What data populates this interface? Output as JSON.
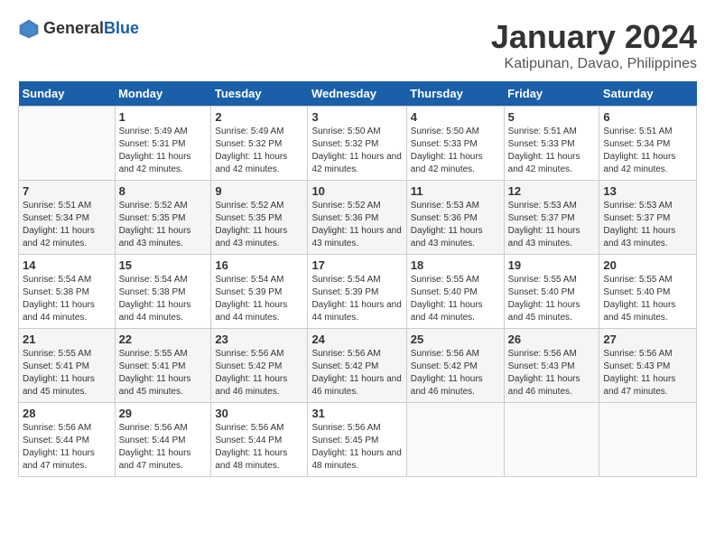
{
  "logo": {
    "text_general": "General",
    "text_blue": "Blue"
  },
  "title": "January 2024",
  "subtitle": "Katipunan, Davao, Philippines",
  "days_of_week": [
    "Sunday",
    "Monday",
    "Tuesday",
    "Wednesday",
    "Thursday",
    "Friday",
    "Saturday"
  ],
  "weeks": [
    [
      {
        "day": "",
        "sunrise": "",
        "sunset": "",
        "daylight": "",
        "empty": true
      },
      {
        "day": "1",
        "sunrise": "Sunrise: 5:49 AM",
        "sunset": "Sunset: 5:31 PM",
        "daylight": "Daylight: 11 hours and 42 minutes."
      },
      {
        "day": "2",
        "sunrise": "Sunrise: 5:49 AM",
        "sunset": "Sunset: 5:32 PM",
        "daylight": "Daylight: 11 hours and 42 minutes."
      },
      {
        "day": "3",
        "sunrise": "Sunrise: 5:50 AM",
        "sunset": "Sunset: 5:32 PM",
        "daylight": "Daylight: 11 hours and 42 minutes."
      },
      {
        "day": "4",
        "sunrise": "Sunrise: 5:50 AM",
        "sunset": "Sunset: 5:33 PM",
        "daylight": "Daylight: 11 hours and 42 minutes."
      },
      {
        "day": "5",
        "sunrise": "Sunrise: 5:51 AM",
        "sunset": "Sunset: 5:33 PM",
        "daylight": "Daylight: 11 hours and 42 minutes."
      },
      {
        "day": "6",
        "sunrise": "Sunrise: 5:51 AM",
        "sunset": "Sunset: 5:34 PM",
        "daylight": "Daylight: 11 hours and 42 minutes."
      }
    ],
    [
      {
        "day": "7",
        "sunrise": "Sunrise: 5:51 AM",
        "sunset": "Sunset: 5:34 PM",
        "daylight": "Daylight: 11 hours and 42 minutes."
      },
      {
        "day": "8",
        "sunrise": "Sunrise: 5:52 AM",
        "sunset": "Sunset: 5:35 PM",
        "daylight": "Daylight: 11 hours and 43 minutes."
      },
      {
        "day": "9",
        "sunrise": "Sunrise: 5:52 AM",
        "sunset": "Sunset: 5:35 PM",
        "daylight": "Daylight: 11 hours and 43 minutes."
      },
      {
        "day": "10",
        "sunrise": "Sunrise: 5:52 AM",
        "sunset": "Sunset: 5:36 PM",
        "daylight": "Daylight: 11 hours and 43 minutes."
      },
      {
        "day": "11",
        "sunrise": "Sunrise: 5:53 AM",
        "sunset": "Sunset: 5:36 PM",
        "daylight": "Daylight: 11 hours and 43 minutes."
      },
      {
        "day": "12",
        "sunrise": "Sunrise: 5:53 AM",
        "sunset": "Sunset: 5:37 PM",
        "daylight": "Daylight: 11 hours and 43 minutes."
      },
      {
        "day": "13",
        "sunrise": "Sunrise: 5:53 AM",
        "sunset": "Sunset: 5:37 PM",
        "daylight": "Daylight: 11 hours and 43 minutes."
      }
    ],
    [
      {
        "day": "14",
        "sunrise": "Sunrise: 5:54 AM",
        "sunset": "Sunset: 5:38 PM",
        "daylight": "Daylight: 11 hours and 44 minutes."
      },
      {
        "day": "15",
        "sunrise": "Sunrise: 5:54 AM",
        "sunset": "Sunset: 5:38 PM",
        "daylight": "Daylight: 11 hours and 44 minutes."
      },
      {
        "day": "16",
        "sunrise": "Sunrise: 5:54 AM",
        "sunset": "Sunset: 5:39 PM",
        "daylight": "Daylight: 11 hours and 44 minutes."
      },
      {
        "day": "17",
        "sunrise": "Sunrise: 5:54 AM",
        "sunset": "Sunset: 5:39 PM",
        "daylight": "Daylight: 11 hours and 44 minutes."
      },
      {
        "day": "18",
        "sunrise": "Sunrise: 5:55 AM",
        "sunset": "Sunset: 5:40 PM",
        "daylight": "Daylight: 11 hours and 44 minutes."
      },
      {
        "day": "19",
        "sunrise": "Sunrise: 5:55 AM",
        "sunset": "Sunset: 5:40 PM",
        "daylight": "Daylight: 11 hours and 45 minutes."
      },
      {
        "day": "20",
        "sunrise": "Sunrise: 5:55 AM",
        "sunset": "Sunset: 5:40 PM",
        "daylight": "Daylight: 11 hours and 45 minutes."
      }
    ],
    [
      {
        "day": "21",
        "sunrise": "Sunrise: 5:55 AM",
        "sunset": "Sunset: 5:41 PM",
        "daylight": "Daylight: 11 hours and 45 minutes."
      },
      {
        "day": "22",
        "sunrise": "Sunrise: 5:55 AM",
        "sunset": "Sunset: 5:41 PM",
        "daylight": "Daylight: 11 hours and 45 minutes."
      },
      {
        "day": "23",
        "sunrise": "Sunrise: 5:56 AM",
        "sunset": "Sunset: 5:42 PM",
        "daylight": "Daylight: 11 hours and 46 minutes."
      },
      {
        "day": "24",
        "sunrise": "Sunrise: 5:56 AM",
        "sunset": "Sunset: 5:42 PM",
        "daylight": "Daylight: 11 hours and 46 minutes."
      },
      {
        "day": "25",
        "sunrise": "Sunrise: 5:56 AM",
        "sunset": "Sunset: 5:42 PM",
        "daylight": "Daylight: 11 hours and 46 minutes."
      },
      {
        "day": "26",
        "sunrise": "Sunrise: 5:56 AM",
        "sunset": "Sunset: 5:43 PM",
        "daylight": "Daylight: 11 hours and 46 minutes."
      },
      {
        "day": "27",
        "sunrise": "Sunrise: 5:56 AM",
        "sunset": "Sunset: 5:43 PM",
        "daylight": "Daylight: 11 hours and 47 minutes."
      }
    ],
    [
      {
        "day": "28",
        "sunrise": "Sunrise: 5:56 AM",
        "sunset": "Sunset: 5:44 PM",
        "daylight": "Daylight: 11 hours and 47 minutes."
      },
      {
        "day": "29",
        "sunrise": "Sunrise: 5:56 AM",
        "sunset": "Sunset: 5:44 PM",
        "daylight": "Daylight: 11 hours and 47 minutes."
      },
      {
        "day": "30",
        "sunrise": "Sunrise: 5:56 AM",
        "sunset": "Sunset: 5:44 PM",
        "daylight": "Daylight: 11 hours and 48 minutes."
      },
      {
        "day": "31",
        "sunrise": "Sunrise: 5:56 AM",
        "sunset": "Sunset: 5:45 PM",
        "daylight": "Daylight: 11 hours and 48 minutes."
      },
      {
        "day": "",
        "sunrise": "",
        "sunset": "",
        "daylight": "",
        "empty": true
      },
      {
        "day": "",
        "sunrise": "",
        "sunset": "",
        "daylight": "",
        "empty": true
      },
      {
        "day": "",
        "sunrise": "",
        "sunset": "",
        "daylight": "",
        "empty": true
      }
    ]
  ]
}
